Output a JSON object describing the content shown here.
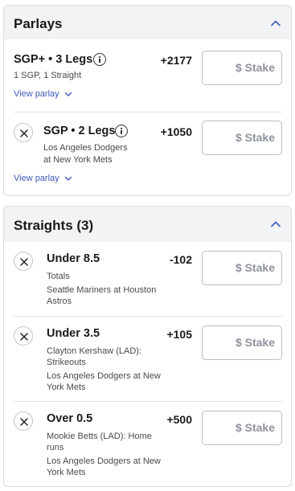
{
  "parlays": {
    "title": "Parlays",
    "items": [
      {
        "title": "SGP+ • 3 Legs",
        "detail": "1 SGP, 1 Straight",
        "odds": "+2177",
        "stake_placeholder": "$ Stake",
        "view_label": "View parlay"
      },
      {
        "title": "SGP • 2 Legs",
        "detail_line1": "Los Angeles Dodgers",
        "detail_line2": "at New York Mets",
        "odds": "+1050",
        "stake_placeholder": "$ Stake",
        "view_label": "View parlay"
      }
    ]
  },
  "straights": {
    "title": "Straights (3)",
    "items": [
      {
        "title": "Under 8.5",
        "line1": "Totals",
        "line2": "Seattle Mariners at Houston",
        "line3": "Astros",
        "odds": "-102",
        "stake_placeholder": "$ Stake"
      },
      {
        "title": "Under 3.5",
        "line1": "Clayton Kershaw (LAD):",
        "line2": "Strikeouts",
        "line3": "Los Angeles Dodgers at New",
        "line4": "York Mets",
        "odds": "+105",
        "stake_placeholder": "$ Stake"
      },
      {
        "title": "Over 0.5",
        "line1": "Mookie Betts (LAD): Home",
        "line2": "runs",
        "line3": "Los Angeles Dodgers at New",
        "line4": "York Mets",
        "odds": "+500",
        "stake_placeholder": "$ Stake"
      }
    ]
  },
  "colors": {
    "link": "#3d5ab8",
    "header_bg": "#f2f3f5",
    "stake_text": "#8e939c"
  },
  "icons": [
    "chevron-up-icon",
    "info-icon",
    "close-icon",
    "chevron-down-icon"
  ]
}
